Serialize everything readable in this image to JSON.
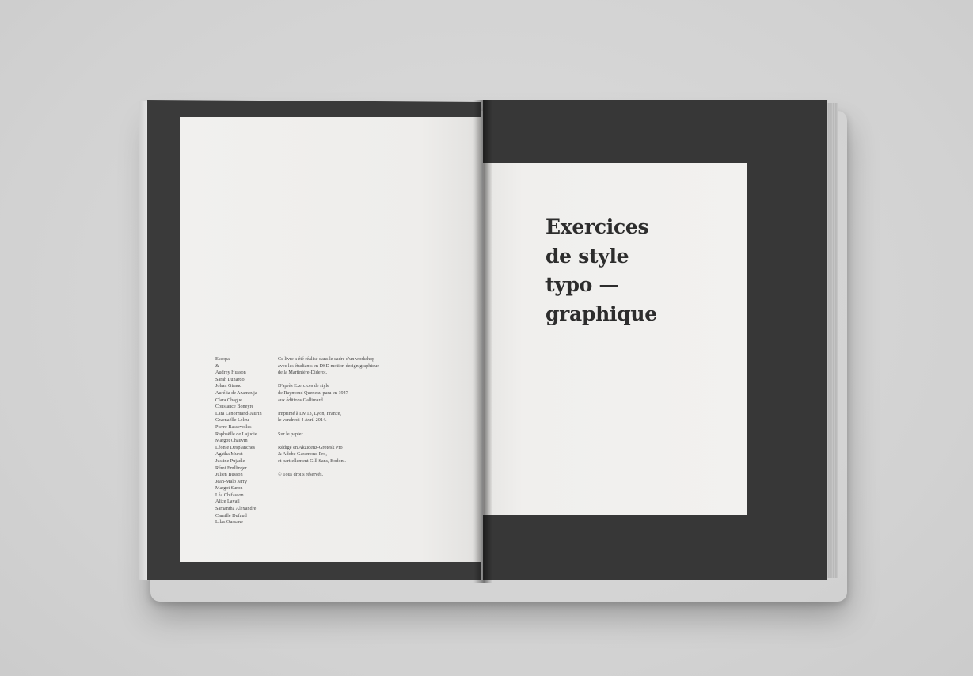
{
  "left_page": {
    "names": [
      "Escopa",
      "&",
      "Audrey Husson",
      "Sarah Lunardo",
      "Johan Giraud",
      "Aurélia de Azambuja",
      "Clara Chague",
      "Constance Boneyre",
      "Lara Lenormand-Jaurin",
      "Gwenaëlle Leleu",
      "Pierre Bassevolles",
      "Raphaëlle de Lajudie",
      "Margot Chauvin",
      "Léonie Desplanches",
      "Agatha Muret",
      "Justine Pujadle",
      "Rémi Emllinger",
      "Julien Busson",
      "Jean-Malo Jarry",
      "Margot Suron",
      "Léa Chifasson",
      "Alice Lavail",
      "Samantha Alexandre",
      "Camille Dufaud",
      "Lilas Oussane"
    ],
    "colophon": [
      [
        "Ce livre a été réalisé dans le cadre d'un workshop",
        "avec les étudiants en DSD motion design graphique",
        "de la Martinière-Diderot."
      ],
      [
        "D'après Exercices de style",
        "de Raymond Queneau paru en 1947",
        "aux éditions Gallimard."
      ],
      [
        "Imprimé à LM13, Lyon, France,",
        "le vendredi 4 Avril 2014."
      ],
      [
        "Sur le papier"
      ],
      [
        "Rédigé en Akzidenz-Grotesk Pro",
        "& Adobe Garamond Pro,",
        "et partiellement Gill Sans, Bodoni."
      ],
      [
        "© Tous droits réservés."
      ]
    ]
  },
  "right_page": {
    "title_lines": [
      "Exercices",
      "de style",
      "typo —",
      "graphique"
    ]
  }
}
